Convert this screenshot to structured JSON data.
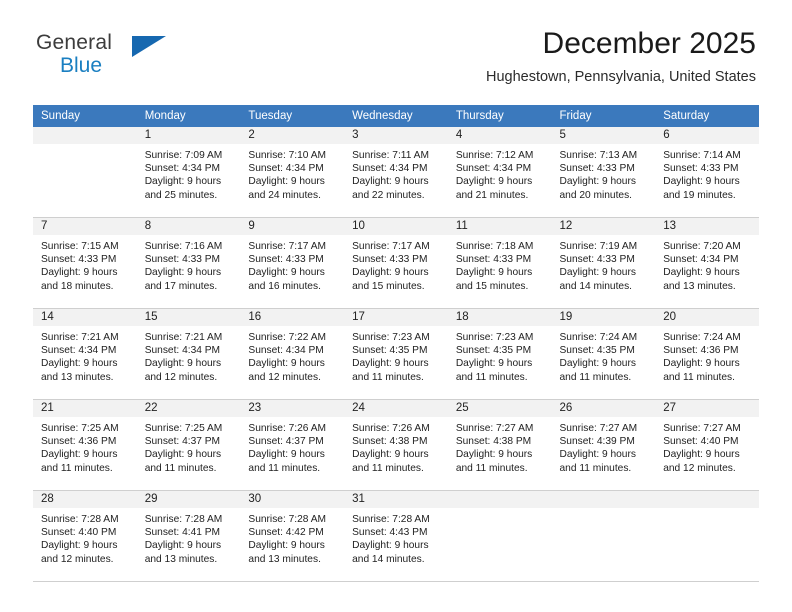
{
  "brand": {
    "name_top": "General",
    "name_bottom": "Blue",
    "flag_icon": "blue-triangle-flag",
    "accent_color": "#1a7fc1"
  },
  "header": {
    "title": "December 2025",
    "subtitle": "Hughestown, Pennsylvania, United States"
  },
  "calendar": {
    "header_bg": "#3b79bd",
    "daynum_bg": "#f2f2f2",
    "weekdays": [
      "Sunday",
      "Monday",
      "Tuesday",
      "Wednesday",
      "Thursday",
      "Friday",
      "Saturday"
    ],
    "weeks": [
      [
        {
          "day": "",
          "lines": []
        },
        {
          "day": "1",
          "lines": [
            "Sunrise: 7:09 AM",
            "Sunset: 4:34 PM",
            "Daylight: 9 hours",
            "and 25 minutes."
          ]
        },
        {
          "day": "2",
          "lines": [
            "Sunrise: 7:10 AM",
            "Sunset: 4:34 PM",
            "Daylight: 9 hours",
            "and 24 minutes."
          ]
        },
        {
          "day": "3",
          "lines": [
            "Sunrise: 7:11 AM",
            "Sunset: 4:34 PM",
            "Daylight: 9 hours",
            "and 22 minutes."
          ]
        },
        {
          "day": "4",
          "lines": [
            "Sunrise: 7:12 AM",
            "Sunset: 4:34 PM",
            "Daylight: 9 hours",
            "and 21 minutes."
          ]
        },
        {
          "day": "5",
          "lines": [
            "Sunrise: 7:13 AM",
            "Sunset: 4:33 PM",
            "Daylight: 9 hours",
            "and 20 minutes."
          ]
        },
        {
          "day": "6",
          "lines": [
            "Sunrise: 7:14 AM",
            "Sunset: 4:33 PM",
            "Daylight: 9 hours",
            "and 19 minutes."
          ]
        }
      ],
      [
        {
          "day": "7",
          "lines": [
            "Sunrise: 7:15 AM",
            "Sunset: 4:33 PM",
            "Daylight: 9 hours",
            "and 18 minutes."
          ]
        },
        {
          "day": "8",
          "lines": [
            "Sunrise: 7:16 AM",
            "Sunset: 4:33 PM",
            "Daylight: 9 hours",
            "and 17 minutes."
          ]
        },
        {
          "day": "9",
          "lines": [
            "Sunrise: 7:17 AM",
            "Sunset: 4:33 PM",
            "Daylight: 9 hours",
            "and 16 minutes."
          ]
        },
        {
          "day": "10",
          "lines": [
            "Sunrise: 7:17 AM",
            "Sunset: 4:33 PM",
            "Daylight: 9 hours",
            "and 15 minutes."
          ]
        },
        {
          "day": "11",
          "lines": [
            "Sunrise: 7:18 AM",
            "Sunset: 4:33 PM",
            "Daylight: 9 hours",
            "and 15 minutes."
          ]
        },
        {
          "day": "12",
          "lines": [
            "Sunrise: 7:19 AM",
            "Sunset: 4:33 PM",
            "Daylight: 9 hours",
            "and 14 minutes."
          ]
        },
        {
          "day": "13",
          "lines": [
            "Sunrise: 7:20 AM",
            "Sunset: 4:34 PM",
            "Daylight: 9 hours",
            "and 13 minutes."
          ]
        }
      ],
      [
        {
          "day": "14",
          "lines": [
            "Sunrise: 7:21 AM",
            "Sunset: 4:34 PM",
            "Daylight: 9 hours",
            "and 13 minutes."
          ]
        },
        {
          "day": "15",
          "lines": [
            "Sunrise: 7:21 AM",
            "Sunset: 4:34 PM",
            "Daylight: 9 hours",
            "and 12 minutes."
          ]
        },
        {
          "day": "16",
          "lines": [
            "Sunrise: 7:22 AM",
            "Sunset: 4:34 PM",
            "Daylight: 9 hours",
            "and 12 minutes."
          ]
        },
        {
          "day": "17",
          "lines": [
            "Sunrise: 7:23 AM",
            "Sunset: 4:35 PM",
            "Daylight: 9 hours",
            "and 11 minutes."
          ]
        },
        {
          "day": "18",
          "lines": [
            "Sunrise: 7:23 AM",
            "Sunset: 4:35 PM",
            "Daylight: 9 hours",
            "and 11 minutes."
          ]
        },
        {
          "day": "19",
          "lines": [
            "Sunrise: 7:24 AM",
            "Sunset: 4:35 PM",
            "Daylight: 9 hours",
            "and 11 minutes."
          ]
        },
        {
          "day": "20",
          "lines": [
            "Sunrise: 7:24 AM",
            "Sunset: 4:36 PM",
            "Daylight: 9 hours",
            "and 11 minutes."
          ]
        }
      ],
      [
        {
          "day": "21",
          "lines": [
            "Sunrise: 7:25 AM",
            "Sunset: 4:36 PM",
            "Daylight: 9 hours",
            "and 11 minutes."
          ]
        },
        {
          "day": "22",
          "lines": [
            "Sunrise: 7:25 AM",
            "Sunset: 4:37 PM",
            "Daylight: 9 hours",
            "and 11 minutes."
          ]
        },
        {
          "day": "23",
          "lines": [
            "Sunrise: 7:26 AM",
            "Sunset: 4:37 PM",
            "Daylight: 9 hours",
            "and 11 minutes."
          ]
        },
        {
          "day": "24",
          "lines": [
            "Sunrise: 7:26 AM",
            "Sunset: 4:38 PM",
            "Daylight: 9 hours",
            "and 11 minutes."
          ]
        },
        {
          "day": "25",
          "lines": [
            "Sunrise: 7:27 AM",
            "Sunset: 4:38 PM",
            "Daylight: 9 hours",
            "and 11 minutes."
          ]
        },
        {
          "day": "26",
          "lines": [
            "Sunrise: 7:27 AM",
            "Sunset: 4:39 PM",
            "Daylight: 9 hours",
            "and 11 minutes."
          ]
        },
        {
          "day": "27",
          "lines": [
            "Sunrise: 7:27 AM",
            "Sunset: 4:40 PM",
            "Daylight: 9 hours",
            "and 12 minutes."
          ]
        }
      ],
      [
        {
          "day": "28",
          "lines": [
            "Sunrise: 7:28 AM",
            "Sunset: 4:40 PM",
            "Daylight: 9 hours",
            "and 12 minutes."
          ]
        },
        {
          "day": "29",
          "lines": [
            "Sunrise: 7:28 AM",
            "Sunset: 4:41 PM",
            "Daylight: 9 hours",
            "and 13 minutes."
          ]
        },
        {
          "day": "30",
          "lines": [
            "Sunrise: 7:28 AM",
            "Sunset: 4:42 PM",
            "Daylight: 9 hours",
            "and 13 minutes."
          ]
        },
        {
          "day": "31",
          "lines": [
            "Sunrise: 7:28 AM",
            "Sunset: 4:43 PM",
            "Daylight: 9 hours",
            "and 14 minutes."
          ]
        },
        {
          "day": "",
          "lines": []
        },
        {
          "day": "",
          "lines": []
        },
        {
          "day": "",
          "lines": []
        }
      ]
    ]
  }
}
